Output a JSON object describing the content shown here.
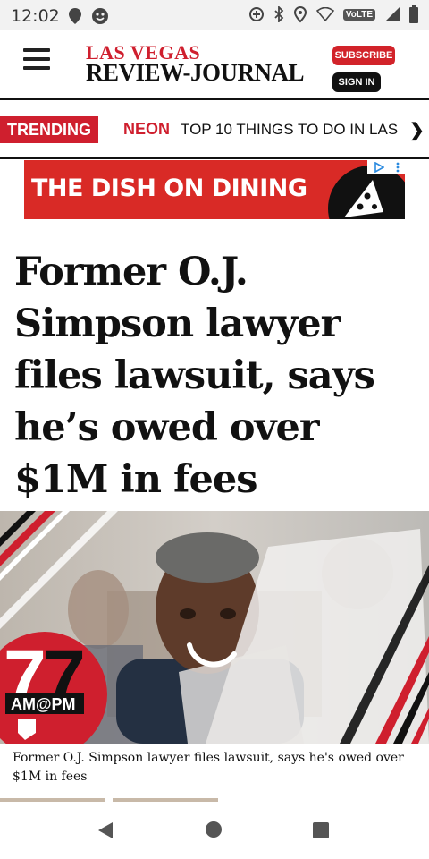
{
  "status_bar": {
    "time": "12:02",
    "network_badge": "VoLTE",
    "icons": [
      "location-pin-icon",
      "face-icon",
      "data-saver-icon",
      "bluetooth-icon",
      "location-icon",
      "wifi-icon",
      "signal-icon",
      "battery-icon"
    ]
  },
  "header": {
    "logo_line1": "LAS VEGAS",
    "logo_line2": "REVIEW-JOURNAL",
    "subscribe_label": "SUBSCRIBE",
    "sign_in_label": "SIGN IN",
    "menu_icon": "hamburger-menu-icon",
    "accent_color": "#cf1f2e"
  },
  "trending": {
    "label": "TRENDING",
    "first_item": "NEON",
    "second_item": "TOP 10 THINGS TO DO IN LAS",
    "arrow_icon": "chevron-right-icon"
  },
  "ad": {
    "text": "THE DISH ON DINING",
    "icon": "pizza-slice-icon",
    "badge_icons": [
      "adchoices-icon",
      "more-vert-icon"
    ]
  },
  "article": {
    "headline": "Former O.J. Simpson lawyer files lawsuit, says he’s owed over $1M in fees",
    "video_logo_top": "7",
    "video_logo_mid": "AM@PM",
    "photo_caption": "Former O.J. Simpson lawyer files lawsuit, says he's owed over $1M in fees"
  },
  "nav_bar": {
    "back_icon": "back-triangle-icon",
    "home_icon": "home-circle-icon",
    "recents_icon": "recents-square-icon"
  }
}
